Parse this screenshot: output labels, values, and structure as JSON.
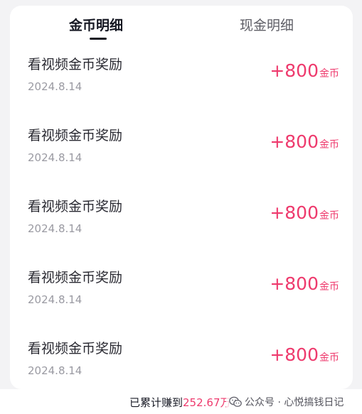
{
  "tabs": {
    "coins": "金币明细",
    "cash": "现金明细"
  },
  "records": [
    {
      "title": "看视频金币奖励",
      "date": "2024.8.14",
      "amount": "+800",
      "unit": "金币"
    },
    {
      "title": "看视频金币奖励",
      "date": "2024.8.14",
      "amount": "+800",
      "unit": "金币"
    },
    {
      "title": "看视频金币奖励",
      "date": "2024.8.14",
      "amount": "+800",
      "unit": "金币"
    },
    {
      "title": "看视频金币奖励",
      "date": "2024.8.14",
      "amount": "+800",
      "unit": "金币"
    },
    {
      "title": "看视频金币奖励",
      "date": "2024.8.14",
      "amount": "+800",
      "unit": "金币"
    }
  ],
  "footer": {
    "label": "已累计赚到",
    "value": "252.67万"
  },
  "watermark": {
    "text": "公众号 · 心悦搞钱日记",
    "icon": "wechat-icon"
  },
  "colors": {
    "accent": "#ee3a6d",
    "text": "#161823",
    "muted": "#9a9aa2",
    "background": "#f3f3f5"
  }
}
